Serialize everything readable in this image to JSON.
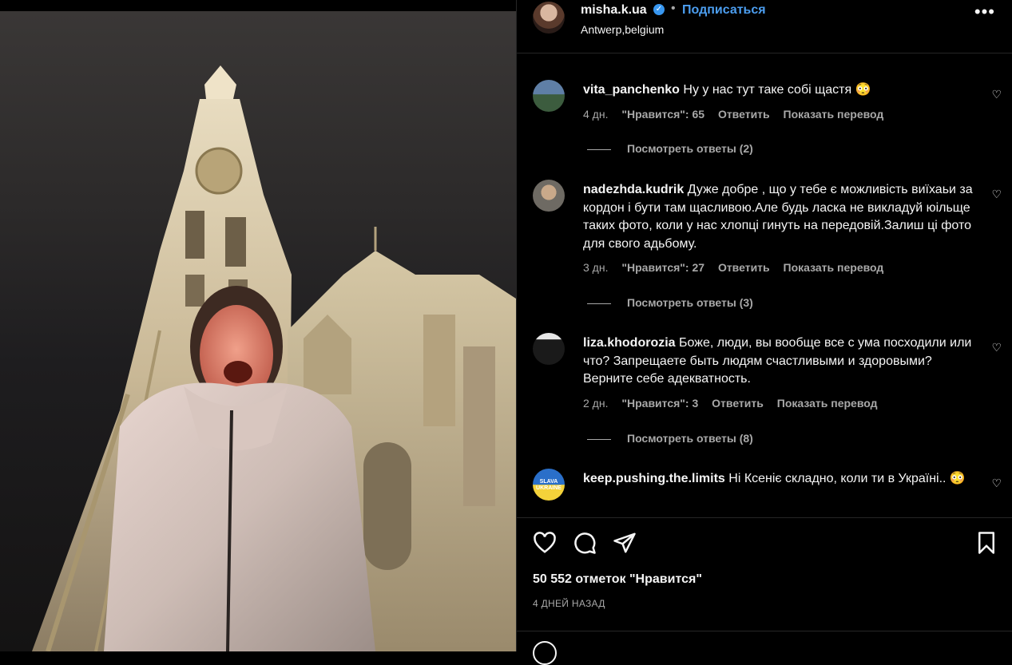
{
  "post": {
    "username": "misha.k.ua",
    "follow_label": "Подписаться",
    "location": "Antwerp,belgium",
    "more_label": "•••",
    "dot": "•"
  },
  "comments": [
    {
      "username": "vita_panchenko",
      "text": "Ну у нас тут таке собі щастя 😳",
      "time": "4 дн.",
      "likes": "\"Нравится\": 65",
      "reply": "Ответить",
      "translate": "Показать перевод",
      "view_replies": "Посмотреть ответы (2)"
    },
    {
      "username": "nadezhda.kudrik",
      "text": "Дуже добре , що у тебе є можливість виїхаьи за кордон і бути там щасливою.Але будь ласка не викладуй юільще таких фото, коли у нас хлопці гинуть на передовій.Залиш ці фото для свого адьбому.",
      "time": "3 дн.",
      "likes": "\"Нравится\": 27",
      "reply": "Ответить",
      "translate": "Показать перевод",
      "view_replies": "Посмотреть ответы (3)"
    },
    {
      "username": "liza.khodorozia",
      "text": "Боже, люди, вы вообще все с ума посходили или что? Запрещаете быть людям счастливыми и здоровыми? Верните себе адекватность.",
      "time": "2 дн.",
      "likes": "\"Нравится\": 3",
      "reply": "Ответить",
      "translate": "Показать перевод",
      "view_replies": "Посмотреть ответы (8)"
    },
    {
      "username": "keep.pushing.the.limits",
      "text": "Ні Ксеніє складно, коли ти в Україні.. 😳",
      "avatar_text": "SLAVA UKRAINE"
    }
  ],
  "likes_count": "50 552 отметок \"Нравится\"",
  "posted_ago": "4 ДНЕЙ НАЗАД",
  "icons": {
    "like": "heart-icon",
    "comment": "comment-icon",
    "share": "share-icon",
    "save": "bookmark-icon"
  },
  "colors": {
    "link_blue": "#4c9ef0",
    "muted": "#a8a8a8",
    "background": "#000000"
  }
}
